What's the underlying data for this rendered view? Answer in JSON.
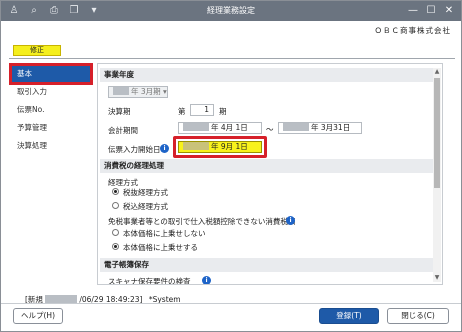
{
  "window": {
    "title": "経理業務設定",
    "company": "ＯＢＣ商事株式会社"
  },
  "toolbar": {
    "icons": [
      "add-user-icon",
      "zoom-icon",
      "print-icon",
      "copy-icon",
      "dropdown-icon"
    ]
  },
  "mode": {
    "label": "修正"
  },
  "sidebar": {
    "items": [
      {
        "label": "基本",
        "active": true
      },
      {
        "label": "取引入力"
      },
      {
        "label": "伝票No."
      },
      {
        "label": "予算管理"
      },
      {
        "label": "決算処理"
      }
    ]
  },
  "sections": {
    "fiscal": {
      "heading": "事業年度",
      "year_select": "年 3月期",
      "period_label": "決算期",
      "period_prefix": "第",
      "period_value": "1",
      "period_suffix": "期",
      "term_label": "会計期間",
      "term_start": "年  4月  1日",
      "term_sep": "～",
      "term_end": "年  3月31日",
      "entry_start_label": "伝票入力開始日",
      "entry_start_value": "年  9月  1日"
    },
    "tax": {
      "heading": "消費税の経理処理",
      "method_label": "経理方式",
      "method_options": [
        "税抜経理方式",
        "税込経理方式"
      ],
      "method_selected": 0,
      "exempt_label": "免税事業者等との取引で仕入税額控除できない消費税額",
      "exempt_options": [
        "本体価格に上乗せしない",
        "本体価格に上乗せする"
      ],
      "exempt_selected": 1
    },
    "ebook": {
      "heading": "電子帳簿保存",
      "scanner_label": "スキャナ保存要件の検査"
    }
  },
  "status": {
    "prefix": "[新規",
    "date": "/06/29 18:49:23]",
    "user": "*System"
  },
  "buttons": {
    "help": "ヘルプ(H)",
    "save": "登録(T)",
    "close": "閉じる(C)"
  }
}
